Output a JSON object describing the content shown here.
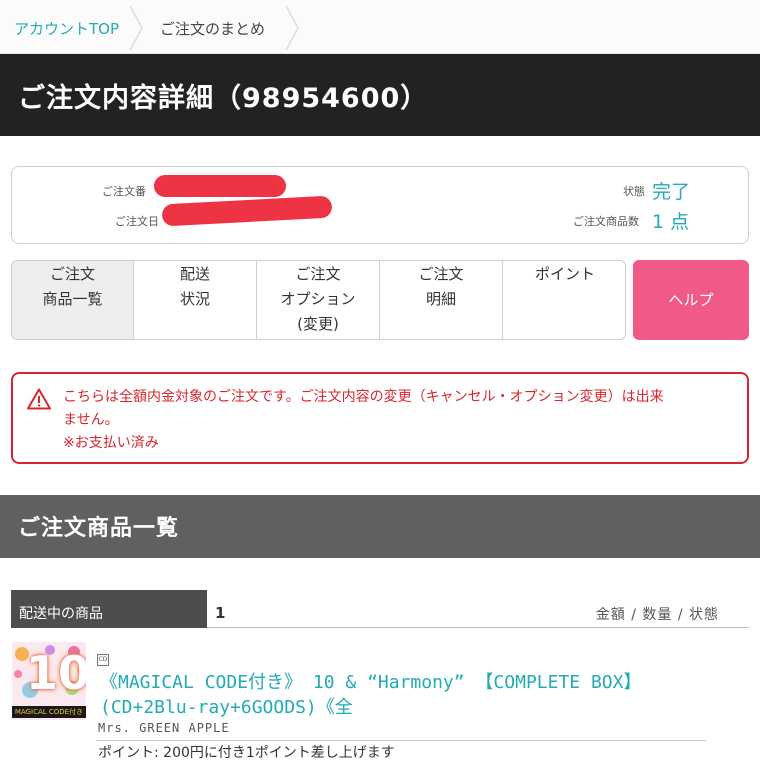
{
  "breadcrumb": {
    "items": [
      {
        "label": "アカウントTOP"
      },
      {
        "label": "ご注文のまとめ"
      }
    ]
  },
  "page_title": "ご注文内容詳細（98954600）",
  "summary": {
    "order_number_label": "ご注文番",
    "order_date_label": "ご注文日",
    "status_label": "状態",
    "status_value": "完了",
    "item_count_label": "ご注文商品数",
    "item_count_value": "1 点",
    "redaction_color": "#ee3344"
  },
  "tabs": [
    {
      "line1": "ご注文",
      "line2": "商品一覧",
      "line3": ""
    },
    {
      "line1": "配送",
      "line2": "状況",
      "line3": ""
    },
    {
      "line1": "ご注文",
      "line2": "オプション",
      "line3": "(変更)"
    },
    {
      "line1": "ご注文",
      "line2": "明細",
      "line3": ""
    },
    {
      "line1": "ポイント",
      "line2": "",
      "line3": ""
    }
  ],
  "help_button": "ヘルプ",
  "warning": {
    "line1": "こちらは全額内金対象のご注文です。ご注文内容の変更（キャンセル・オプション変更）は出来",
    "line2": "ません。",
    "line3": "※お支払い済み"
  },
  "section_title": "ご注文商品一覧",
  "items_header": {
    "shipping_label": "配送中の商品",
    "count": "1",
    "columns": "金額 / 数量 / 状態"
  },
  "item": {
    "thumb_number": "10",
    "thumb_caption": "MAGICAL CODE付き",
    "badge": "CD",
    "title_line1": "《MAGICAL CODE付き》 10 & “Harmony” 【COMPLETE BOX】",
    "title_line2": "(CD+2Blu-ray+6GOODS)《全",
    "artist": "Mrs. GREEN APPLE",
    "points": "ポイント: 200円に付き1ポイント差し上げます"
  },
  "colors": {
    "accent": "#23aab5",
    "title_bar": "#222222",
    "section_bar": "#606060",
    "help": "#f15a87",
    "warning": "#d9252f"
  }
}
